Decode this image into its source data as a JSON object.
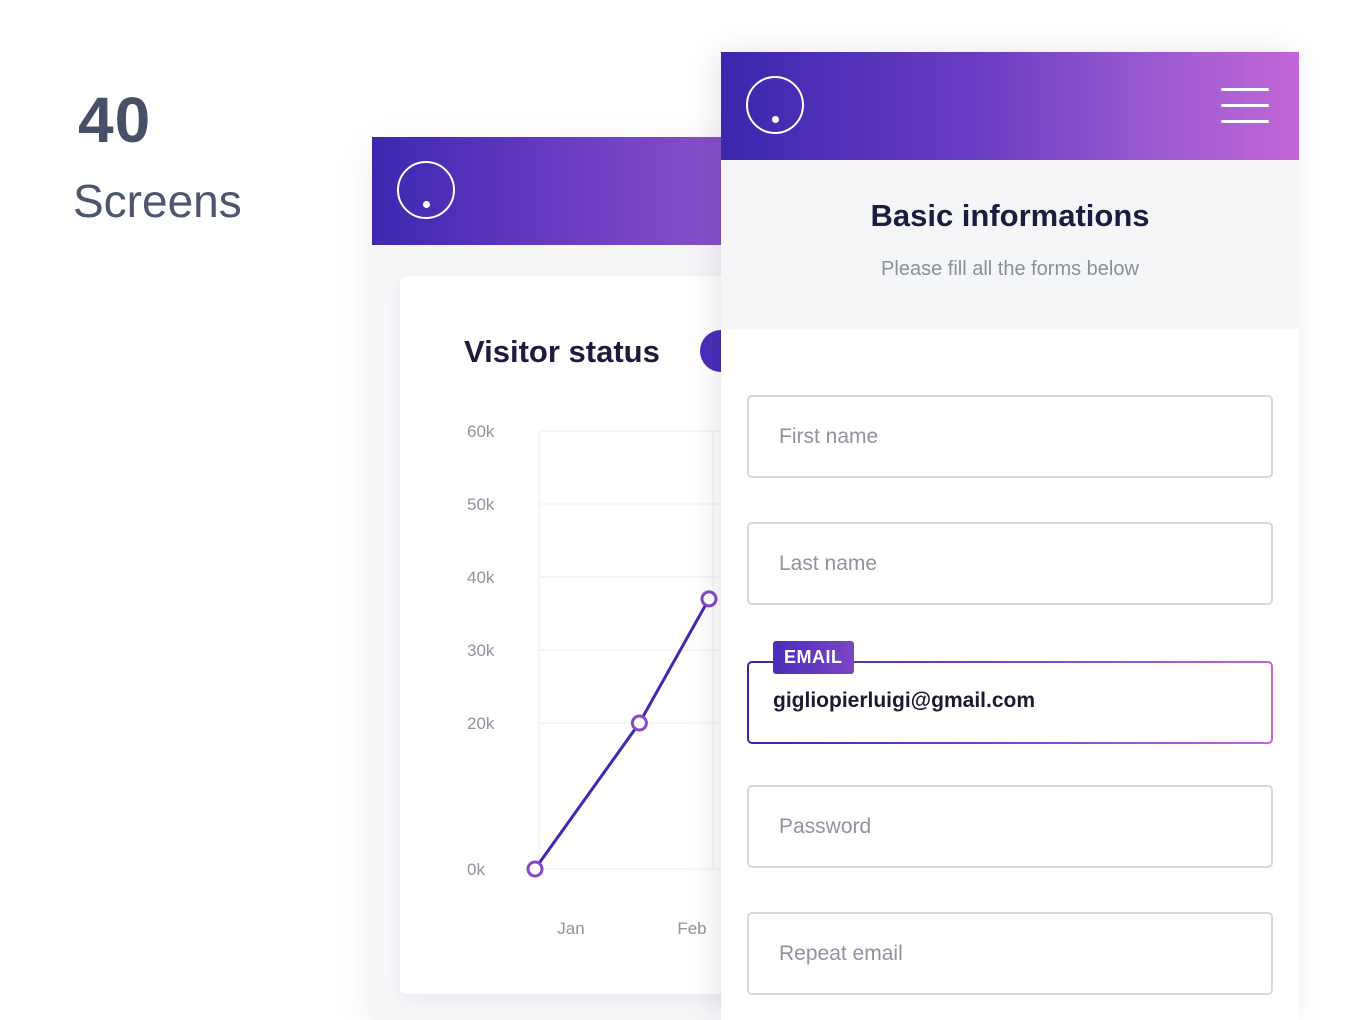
{
  "promo": {
    "count": "40",
    "label": "Screens"
  },
  "chart_screen": {
    "logo_icon": "circle-dot-logo",
    "title": "Visitor status"
  },
  "form_screen": {
    "logo_icon": "circle-dot-logo",
    "menu_icon": "hamburger-menu-icon",
    "title": "Basic informations",
    "subtitle": "Please fill all the forms below",
    "fields": {
      "first_name": {
        "placeholder": "First name"
      },
      "last_name": {
        "placeholder": "Last name"
      },
      "email": {
        "label": "EMAIL",
        "value": "gigliopierluigi@gmail.com"
      },
      "password": {
        "placeholder": "Password"
      },
      "repeat_email": {
        "placeholder": "Repeat email"
      }
    }
  },
  "colors": {
    "accent": "#4a2db8",
    "accent_light": "#c266d6",
    "text_dark": "#1d1c3f"
  },
  "chart_data": {
    "type": "line",
    "title": "Visitor status",
    "categories": [
      "Jan",
      "Feb"
    ],
    "x": [
      0,
      0.6,
      1
    ],
    "series": [
      {
        "values": [
          0,
          20000,
          37000
        ]
      }
    ],
    "y_ticks": [
      "0k",
      "20k",
      "30k",
      "40k",
      "50k",
      "60k"
    ],
    "ylim": [
      0,
      60000
    ],
    "grid": true
  }
}
